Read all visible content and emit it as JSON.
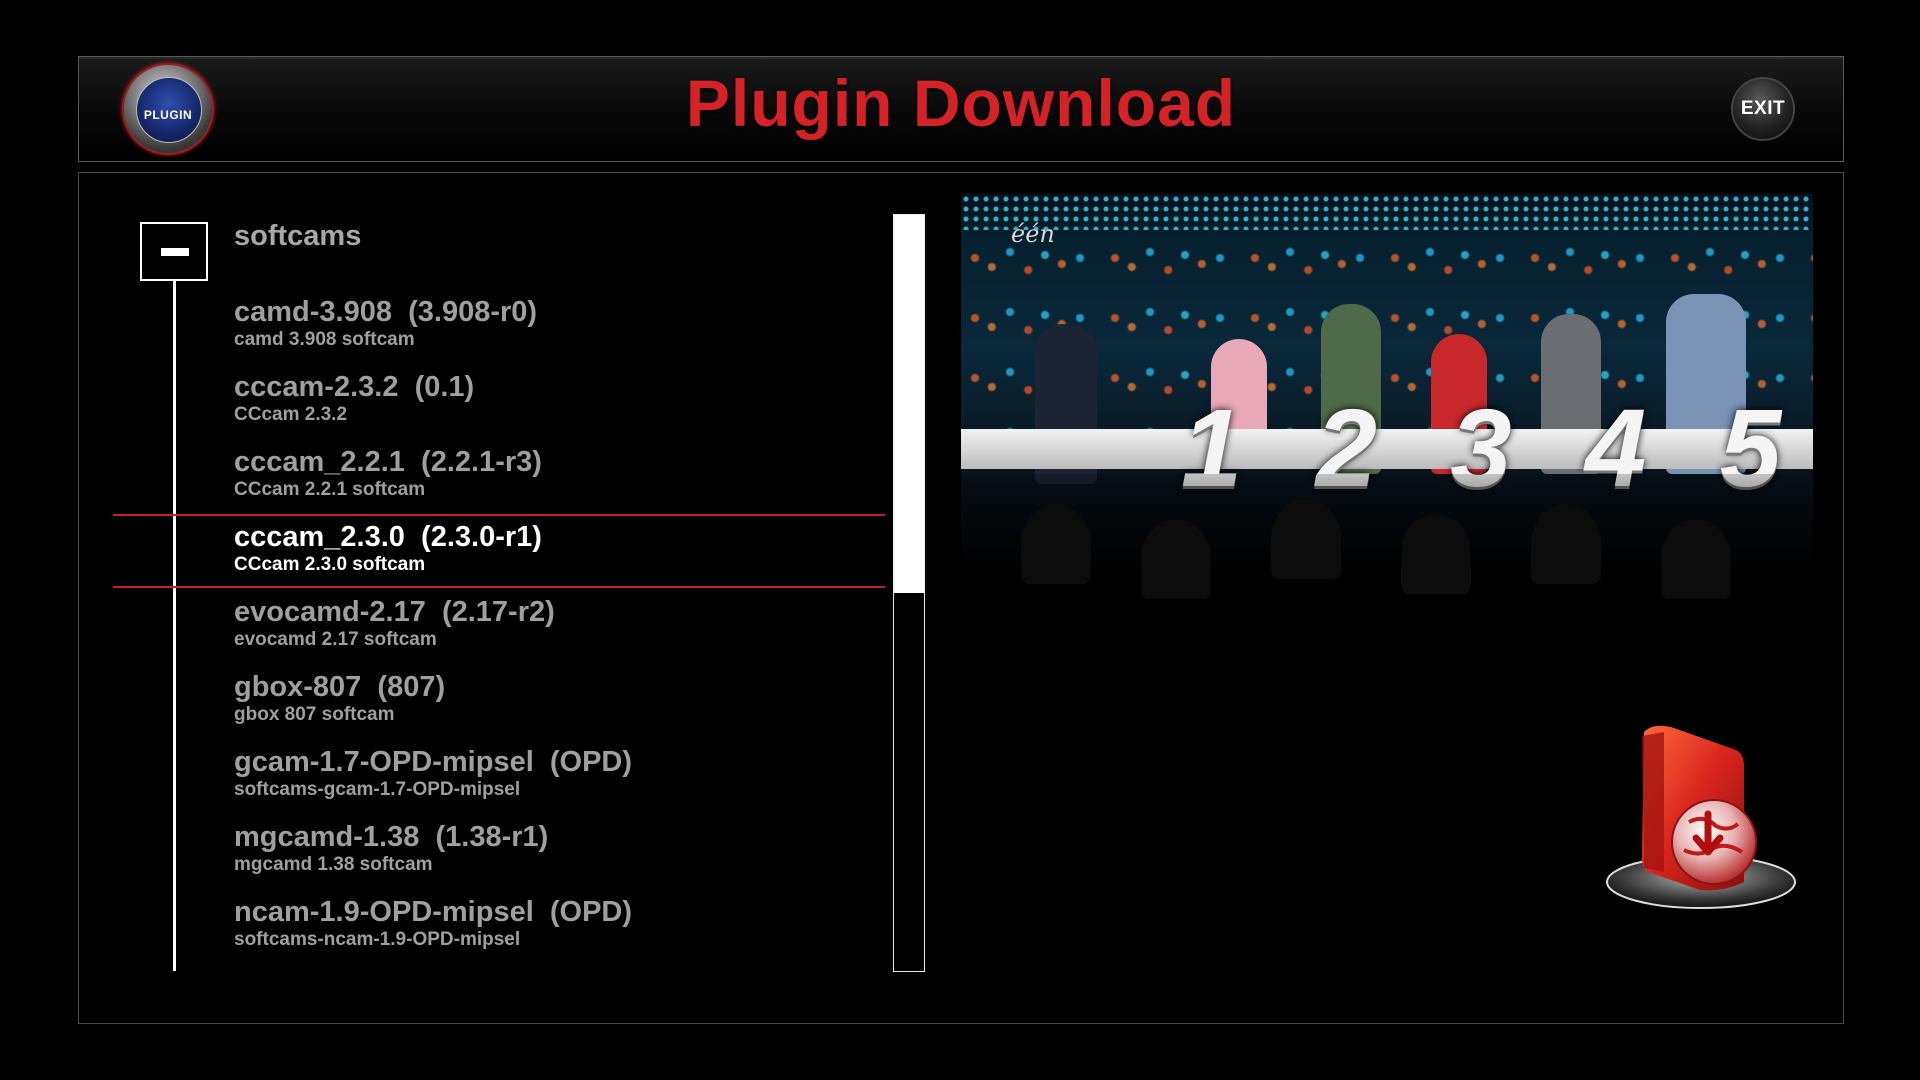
{
  "header": {
    "title": "Plugin Download",
    "logo_text": "PLUGIN",
    "exit_label": "EXIT"
  },
  "tree": {
    "category": "softcams",
    "items": [
      {
        "name": "camd-3.908  (3.908-r0)",
        "desc": "camd 3.908 softcam"
      },
      {
        "name": "cccam-2.3.2  (0.1)",
        "desc": "CCcam 2.3.2"
      },
      {
        "name": "cccam_2.2.1  (2.2.1-r3)",
        "desc": "CCcam 2.2.1 softcam"
      },
      {
        "name": "cccam_2.3.0  (2.3.0-r1)",
        "desc": "CCcam 2.3.0 softcam"
      },
      {
        "name": "evocamd-2.17  (2.17-r2)",
        "desc": "evocamd 2.17 softcam"
      },
      {
        "name": "gbox-807  (807)",
        "desc": "gbox 807 softcam"
      },
      {
        "name": "gcam-1.7-OPD-mipsel  (OPD)",
        "desc": "softcams-gcam-1.7-OPD-mipsel"
      },
      {
        "name": "mgcamd-1.38  (1.38-r1)",
        "desc": "mgcamd 1.38 softcam"
      },
      {
        "name": "ncam-1.9-OPD-mipsel  (OPD)",
        "desc": "softcams-ncam-1.9-OPD-mipsel"
      }
    ],
    "selected_index": 3
  },
  "scroll": {
    "thumb_fraction": 0.5,
    "position_fraction": 0.0
  },
  "preview": {
    "watermark": "één",
    "numbers": [
      "1",
      "2",
      "3",
      "4",
      "5"
    ]
  },
  "colors": {
    "accent_red": "#d42226",
    "selection_line": "#c12028",
    "text_normal": "#9f9f9f",
    "text_selected": "#ffffff"
  }
}
